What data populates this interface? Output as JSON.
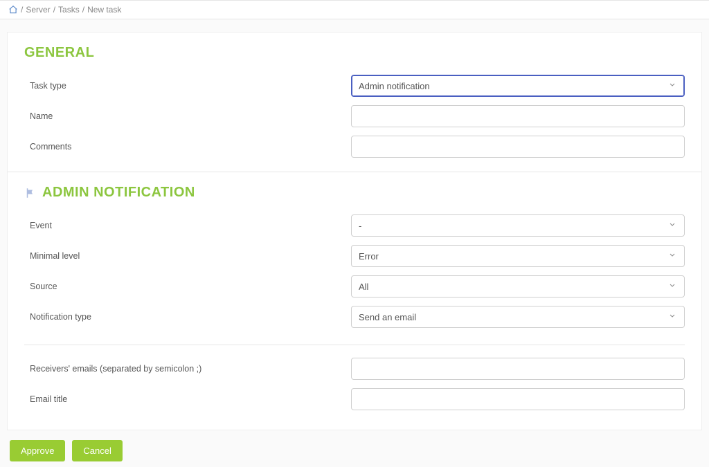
{
  "breadcrumb": {
    "server": "Server",
    "tasks": "Tasks",
    "new_task": "New task",
    "sep": " / "
  },
  "general": {
    "title": "GENERAL",
    "task_type_label": "Task type",
    "task_type_value": "Admin notification",
    "name_label": "Name",
    "name_value": "",
    "comments_label": "Comments",
    "comments_value": ""
  },
  "admin_notification": {
    "title": "ADMIN NOTIFICATION",
    "event_label": "Event",
    "event_value": "-",
    "minimal_level_label": "Minimal level",
    "minimal_level_value": "Error",
    "source_label": "Source",
    "source_value": "All",
    "notification_type_label": "Notification type",
    "notification_type_value": "Send an email",
    "receivers_label": "Receivers' emails (separated by semicolon ;)",
    "receivers_value": "",
    "email_title_label": "Email title",
    "email_title_value": ""
  },
  "actions": {
    "approve": "Approve",
    "cancel": "Cancel"
  }
}
